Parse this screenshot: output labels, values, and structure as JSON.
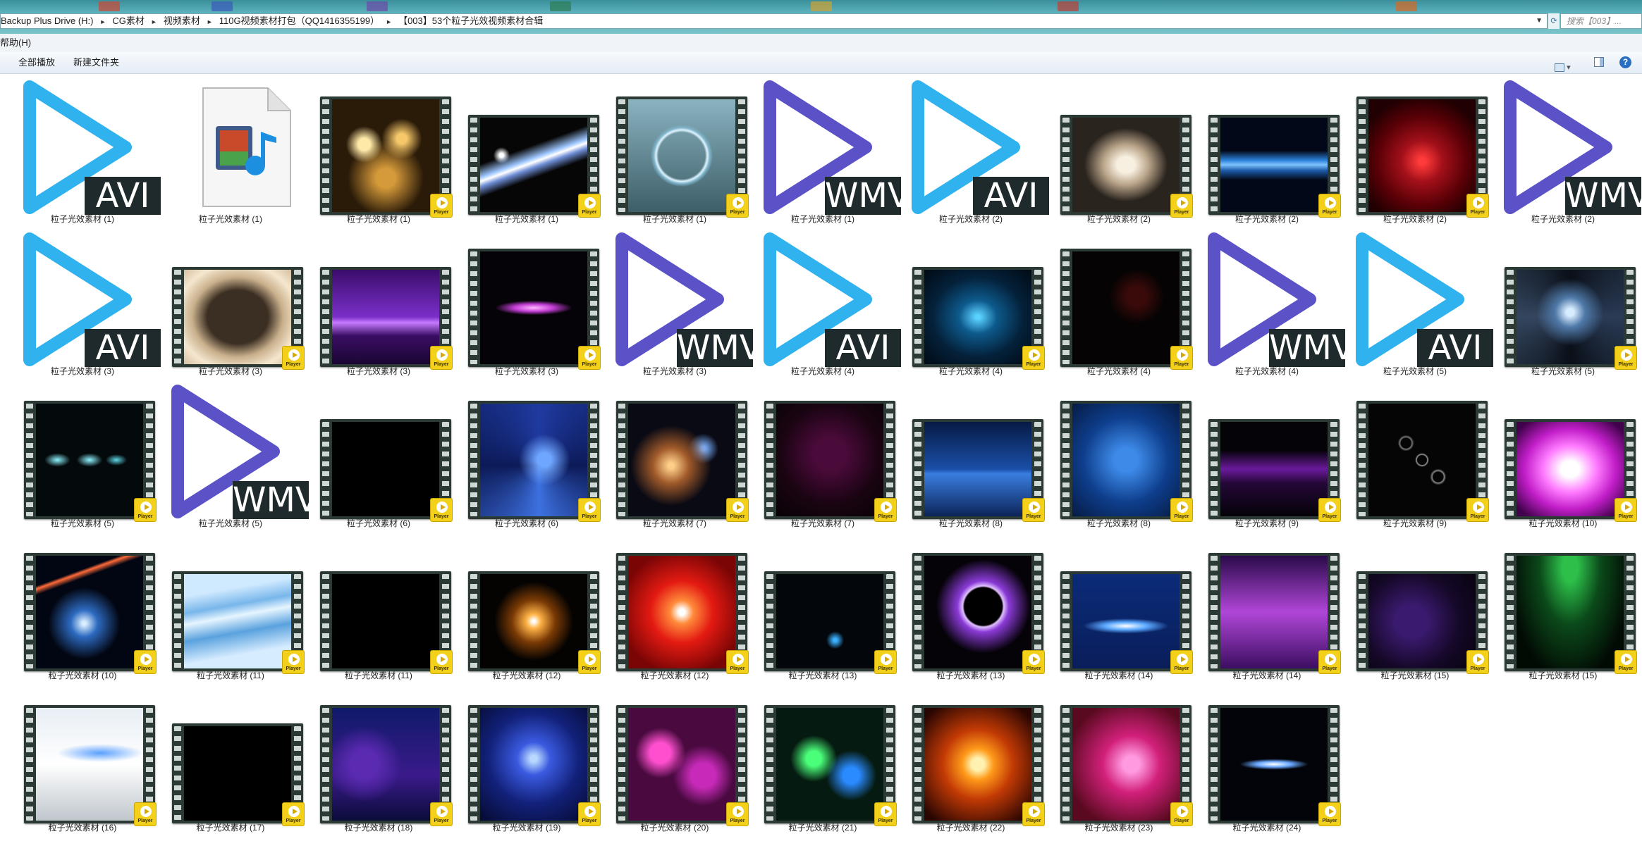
{
  "window": {
    "address_segments": [
      "Backup Plus Drive (H:)",
      "CG素材",
      "视频素材",
      "110G视频素材打包（QQ1416355199）",
      "【003】53个粒子光效视频素材合辑"
    ],
    "search_placeholder": "搜索【003】..."
  },
  "menubar": {
    "help": "帮助(H)"
  },
  "toolbar": {
    "play_all": "全部播放",
    "new_folder": "新建文件夹"
  },
  "icons": {
    "badge_text": "Player",
    "ext_avi": "AVI",
    "ext_wmv": "WMV"
  },
  "colors": {
    "avi_play": "#2fb2ee",
    "wmv_play": "#5b52c8",
    "badge": "#f3d01a",
    "ext_bg": "#1f2a2c"
  },
  "files": [
    {
      "label": "粒子光效素材 (1)",
      "kind": "avi"
    },
    {
      "label": "粒子光效素材 (1)",
      "kind": "doc"
    },
    {
      "label": "粒子光效素材 (1)",
      "kind": "film",
      "scene": "gold-particles"
    },
    {
      "label": "粒子光效素材 (1)",
      "kind": "film",
      "scene": "diagonal-streak"
    },
    {
      "label": "粒子光效素材 (1)",
      "kind": "film",
      "scene": "ring-light"
    },
    {
      "label": "粒子光效素材 (1)",
      "kind": "wmv"
    },
    {
      "label": "粒子光效素材 (2)",
      "kind": "avi"
    },
    {
      "label": "粒子光效素材 (2)",
      "kind": "film",
      "scene": "bokeh-band"
    },
    {
      "label": "粒子光效素材 (2)",
      "kind": "film",
      "scene": "blue-wave"
    },
    {
      "label": "粒子光效素材 (2)",
      "kind": "film",
      "scene": "red-circle"
    },
    {
      "label": "粒子光效素材 (2)",
      "kind": "wmv"
    },
    {
      "label": "粒子光效素材 (3)",
      "kind": "avi"
    },
    {
      "label": "粒子光效素材 (3)",
      "kind": "film",
      "scene": "bokeh-frame"
    },
    {
      "label": "粒子光效素材 (3)",
      "kind": "film",
      "scene": "purple-stage"
    },
    {
      "label": "粒子光效素材 (3)",
      "kind": "film",
      "scene": "purple-burst"
    },
    {
      "label": "粒子光效素材 (3)",
      "kind": "wmv"
    },
    {
      "label": "粒子光效素材 (4)",
      "kind": "avi"
    },
    {
      "label": "粒子光效素材 (4)",
      "kind": "film",
      "scene": "blue-glow"
    },
    {
      "label": "粒子光效素材 (4)",
      "kind": "film",
      "scene": "dark-red-dots"
    },
    {
      "label": "粒子光效素材 (4)",
      "kind": "wmv"
    },
    {
      "label": "粒子光效素材 (5)",
      "kind": "avi"
    },
    {
      "label": "粒子光效素材 (5)",
      "kind": "film",
      "scene": "light-rays"
    },
    {
      "label": "粒子光效素材 (5)",
      "kind": "film",
      "scene": "cyan-dots"
    },
    {
      "label": "粒子光效素材 (5)",
      "kind": "wmv"
    },
    {
      "label": "粒子光效素材 (6)",
      "kind": "film",
      "scene": "black"
    },
    {
      "label": "粒子光效素材 (6)",
      "kind": "film",
      "scene": "blue-swirl"
    },
    {
      "label": "粒子光效素材 (7)",
      "kind": "film",
      "scene": "star-field"
    },
    {
      "label": "粒子光效素材 (7)",
      "kind": "film",
      "scene": "dark-magenta"
    },
    {
      "label": "粒子光效素材 (8)",
      "kind": "film",
      "scene": "blue-horizon"
    },
    {
      "label": "粒子光效素材 (8)",
      "kind": "film",
      "scene": "blue-digits"
    },
    {
      "label": "粒子光效素材 (9)",
      "kind": "film",
      "scene": "purple-smoke"
    },
    {
      "label": "粒子光效素材 (9)",
      "kind": "film",
      "scene": "bubbles"
    },
    {
      "label": "粒子光效素材 (10)",
      "kind": "film",
      "scene": "pink-flare"
    },
    {
      "label": "粒子光效素材 (10)",
      "kind": "film",
      "scene": "blue-flare"
    },
    {
      "label": "粒子光效素材 (11)",
      "kind": "film",
      "scene": "light-waves"
    },
    {
      "label": "粒子光效素材 (11)",
      "kind": "film",
      "scene": "black"
    },
    {
      "label": "粒子光效素材 (12)",
      "kind": "film",
      "scene": "orange-star"
    },
    {
      "label": "粒子光效素材 (12)",
      "kind": "film",
      "scene": "red-burst"
    },
    {
      "label": "粒子光效素材 (13)",
      "kind": "film",
      "scene": "faint-blue"
    },
    {
      "label": "粒子光效素材 (13)",
      "kind": "film",
      "scene": "eclipse"
    },
    {
      "label": "粒子光效素材 (14)",
      "kind": "film",
      "scene": "blue-beam"
    },
    {
      "label": "粒子光效素材 (14)",
      "kind": "film",
      "scene": "purple-grid"
    },
    {
      "label": "粒子光效素材 (15)",
      "kind": "film",
      "scene": "purple-dark"
    },
    {
      "label": "粒子光效素材 (15)",
      "kind": "film",
      "scene": "green-rain"
    },
    {
      "label": "粒子光效素材 (16)",
      "kind": "film",
      "scene": "white-blue"
    },
    {
      "label": "粒子光效素材 (17)",
      "kind": "film",
      "scene": "black"
    },
    {
      "label": "粒子光效素材 (18)",
      "kind": "film",
      "scene": "blue-purple"
    },
    {
      "label": "粒子光效素材 (19)",
      "kind": "film",
      "scene": "blue-nebula"
    },
    {
      "label": "粒子光效素材 (20)",
      "kind": "film",
      "scene": "magenta-bokeh"
    },
    {
      "label": "粒子光效素材 (21)",
      "kind": "film",
      "scene": "green-bokeh"
    },
    {
      "label": "粒子光效素材 (22)",
      "kind": "film",
      "scene": "orange-bokeh"
    },
    {
      "label": "粒子光效素材 (23)",
      "kind": "film",
      "scene": "pink-red-bokeh"
    },
    {
      "label": "粒子光效素材 (24)",
      "kind": "film",
      "scene": "blue-streak"
    }
  ]
}
